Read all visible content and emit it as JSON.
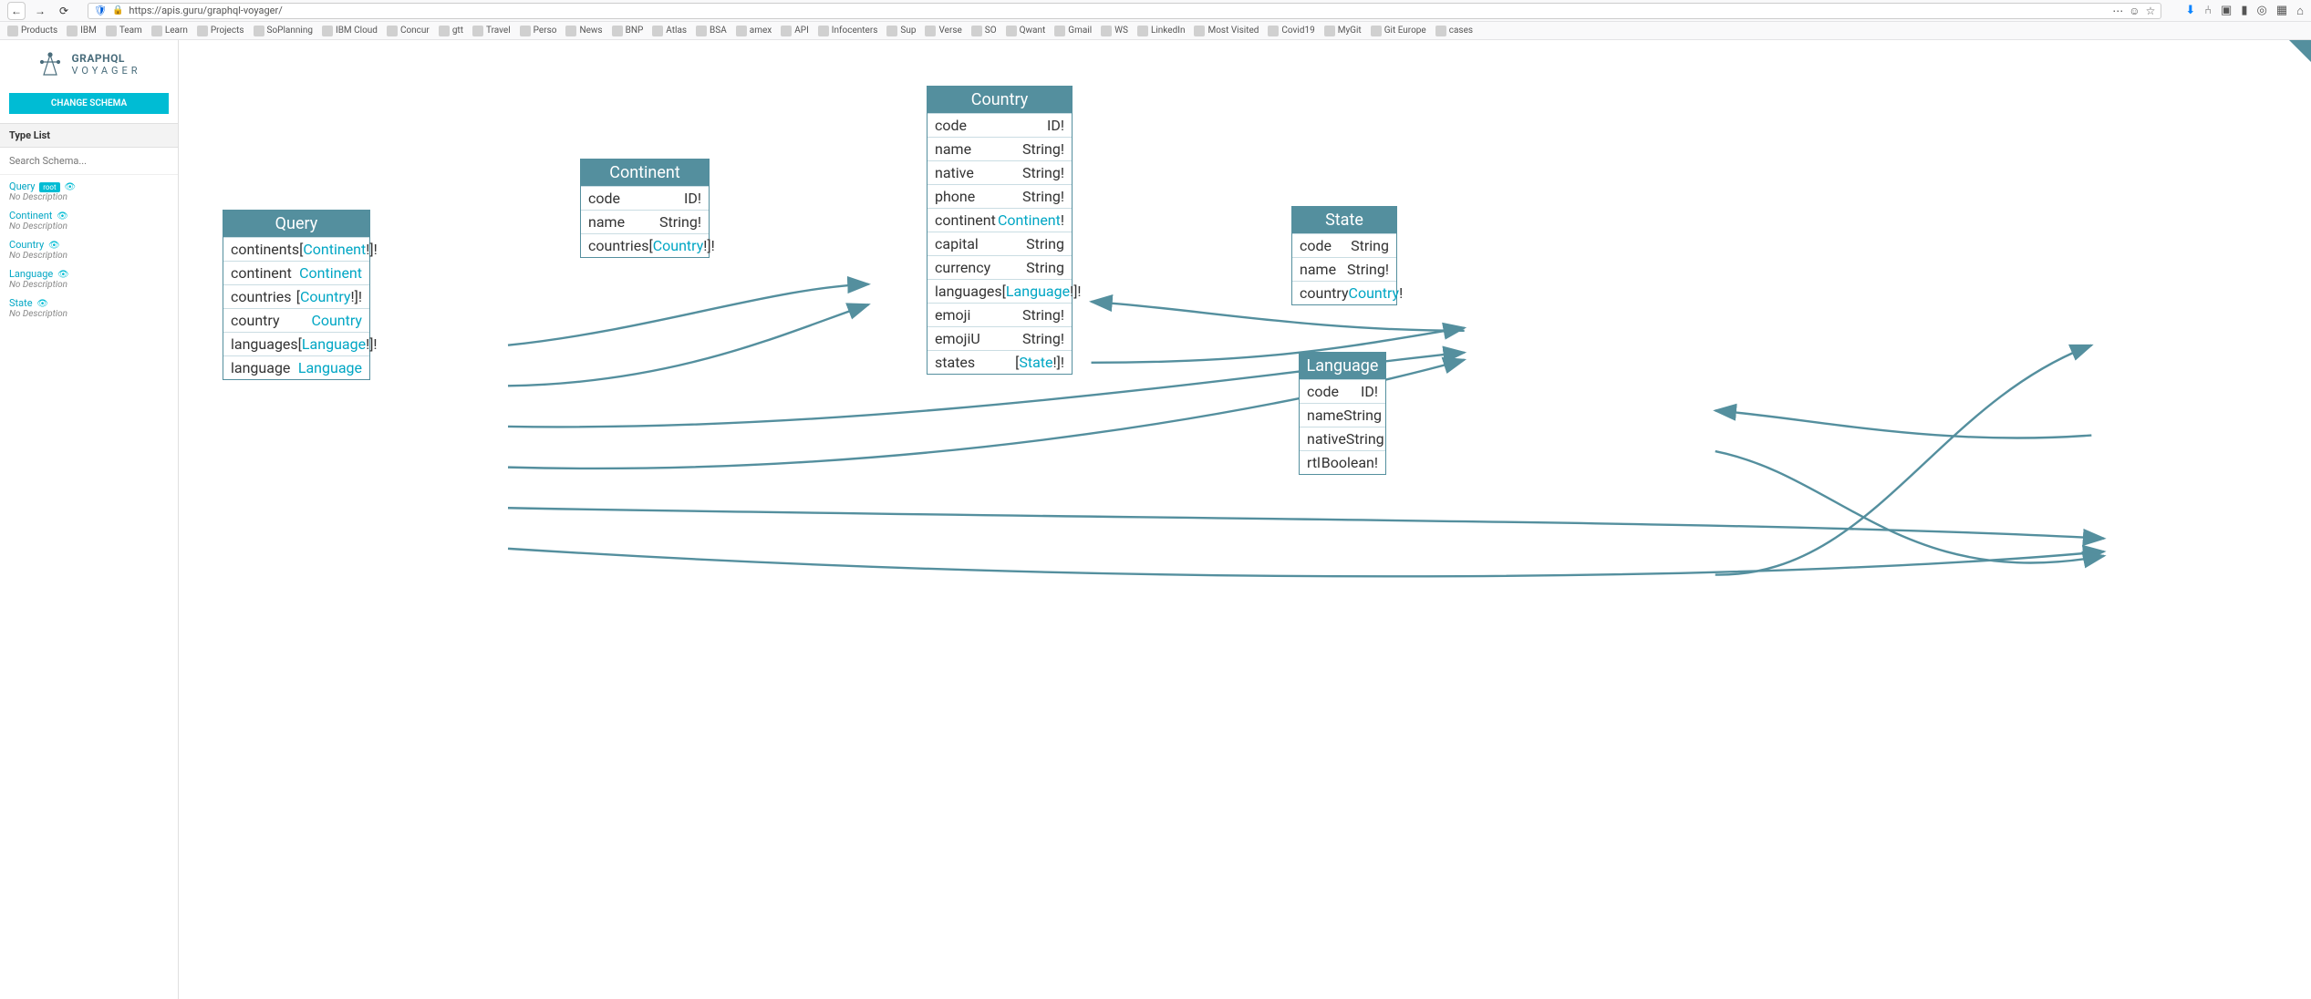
{
  "browser": {
    "url": "https://apis.guru/graphql-voyager/"
  },
  "bookmarks": [
    "Products",
    "IBM",
    "Team",
    "Learn",
    "Projects",
    "SoPlanning",
    "IBM Cloud",
    "Concur",
    "gtt",
    "Travel",
    "Perso",
    "News",
    "BNP",
    "Atlas",
    "BSA",
    "amex",
    "API",
    "Infocenters",
    "Sup",
    "Verse",
    "SO",
    "Qwant",
    "Gmail",
    "WS",
    "LinkedIn",
    "Most Visited",
    "Covid19",
    "MyGit",
    "Git Europe",
    "cases"
  ],
  "sidebar": {
    "logo_main": "GRAPHQL",
    "logo_sub": "VOYAGER",
    "change_schema": "CHANGE SCHEMA",
    "type_list_header": "Type List",
    "search_placeholder": "Search Schema...",
    "root_label": "root",
    "no_desc": "No Description",
    "types": [
      {
        "name": "Query",
        "root": true
      },
      {
        "name": "Continent",
        "root": false
      },
      {
        "name": "Country",
        "root": false
      },
      {
        "name": "Language",
        "root": false
      },
      {
        "name": "State",
        "root": false
      }
    ]
  },
  "nodes": {
    "query": {
      "title": "Query",
      "fields": [
        {
          "name": "continents",
          "type": "Continent",
          "list": true,
          "nn": true,
          "link": true
        },
        {
          "name": "continent",
          "type": "Continent",
          "list": false,
          "nn": false,
          "link": true
        },
        {
          "name": "countries",
          "type": "Country",
          "list": true,
          "nn": true,
          "link": true
        },
        {
          "name": "country",
          "type": "Country",
          "list": false,
          "nn": false,
          "link": true
        },
        {
          "name": "languages",
          "type": "Language",
          "list": true,
          "nn": true,
          "link": true
        },
        {
          "name": "language",
          "type": "Language",
          "list": false,
          "nn": false,
          "link": true
        }
      ]
    },
    "continent": {
      "title": "Continent",
      "fields": [
        {
          "name": "code",
          "type": "ID!",
          "link": false
        },
        {
          "name": "name",
          "type": "String!",
          "link": false
        },
        {
          "name": "countries",
          "type": "Country",
          "list": true,
          "nn": true,
          "link": true
        }
      ]
    },
    "country": {
      "title": "Country",
      "fields": [
        {
          "name": "code",
          "type": "ID!",
          "link": false
        },
        {
          "name": "name",
          "type": "String!",
          "link": false
        },
        {
          "name": "native",
          "type": "String!",
          "link": false
        },
        {
          "name": "phone",
          "type": "String!",
          "link": false
        },
        {
          "name": "continent",
          "type": "Continent",
          "nn": true,
          "link": true
        },
        {
          "name": "capital",
          "type": "String",
          "link": false
        },
        {
          "name": "currency",
          "type": "String",
          "link": false
        },
        {
          "name": "languages",
          "type": "Language",
          "list": true,
          "nn": true,
          "link": true
        },
        {
          "name": "emoji",
          "type": "String!",
          "link": false
        },
        {
          "name": "emojiU",
          "type": "String!",
          "link": false
        },
        {
          "name": "states",
          "type": "State",
          "list": true,
          "nn": true,
          "link": true
        }
      ]
    },
    "state": {
      "title": "State",
      "fields": [
        {
          "name": "code",
          "type": "String",
          "link": false
        },
        {
          "name": "name",
          "type": "String!",
          "link": false
        },
        {
          "name": "country",
          "type": "Country",
          "nn": true,
          "link": true
        }
      ]
    },
    "language": {
      "title": "Language",
      "fields": [
        {
          "name": "code",
          "type": "ID!",
          "link": false
        },
        {
          "name": "name",
          "type": "String",
          "link": false
        },
        {
          "name": "native",
          "type": "String",
          "link": false
        },
        {
          "name": "rtl",
          "type": "Boolean!",
          "link": false
        }
      ]
    }
  }
}
